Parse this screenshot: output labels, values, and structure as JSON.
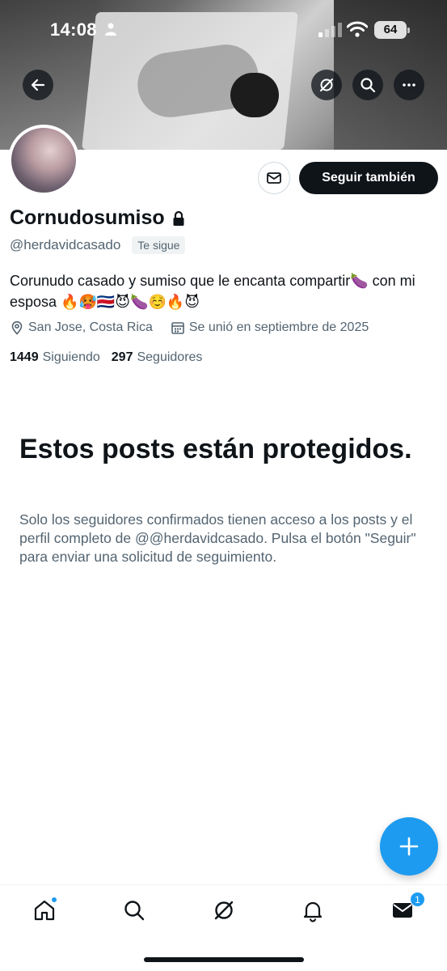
{
  "status_bar": {
    "time": "14:08",
    "battery": "64"
  },
  "profile": {
    "name": "Cornudosumiso",
    "handle": "@herdavidcasado",
    "follows_you_badge": "Te sigue",
    "bio": "Corunudo casado y sumiso que le encanta compartir🍆 con mi esposa 🔥🥵🇨🇷😈🍆☺️🔥😈",
    "location": "San Jose, Costa Rica",
    "joined": "Se unió en septiembre de 2025",
    "following_count": "1449",
    "following_label": "Siguiendo",
    "followers_count": "297",
    "followers_label": "Seguidores"
  },
  "actions": {
    "follow_label": "Seguir también"
  },
  "protected": {
    "title": "Estos posts están protegidos.",
    "description": "Solo los seguidores confirmados tienen acceso a los posts y el perfil completo de @@herdavidcasado. Pulsa el botón \"Seguir\" para enviar una solicitud de seguimiento."
  },
  "tabbar": {
    "messages_badge": "1"
  },
  "icons": {
    "back": "back-arrow-icon",
    "grok": "grok-icon",
    "search": "search-icon",
    "more": "more-icon",
    "message": "envelope-icon",
    "lock": "lock-icon",
    "location": "location-pin-icon",
    "calendar": "calendar-icon",
    "compose": "plus-icon",
    "home": "home-icon",
    "notifications": "bell-icon"
  },
  "colors": {
    "accent": "#1d9bf0",
    "text": "#0f1419",
    "secondary_text": "#536471",
    "button_dark": "#0f1419"
  }
}
